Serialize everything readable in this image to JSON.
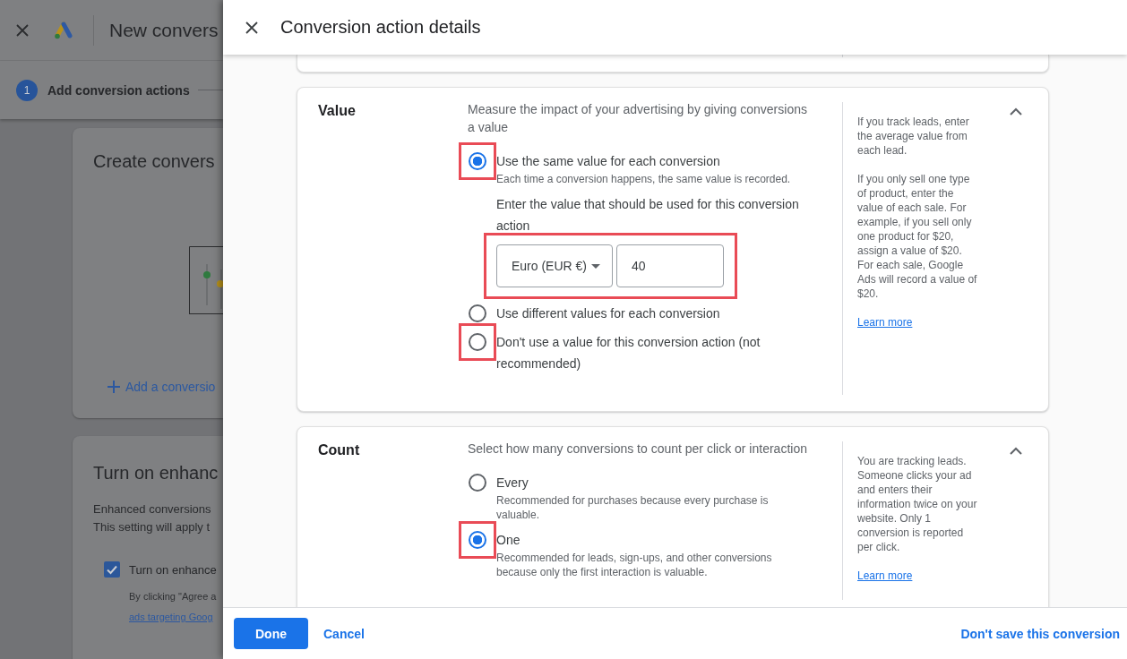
{
  "background_page": {
    "header": {
      "title": "New convers"
    },
    "stepper": [
      {
        "number": "1",
        "label": "Add conversion actions"
      }
    ],
    "create_card": {
      "title": "Create convers",
      "add_link": "Add a conversio"
    },
    "enhanced_card": {
      "title": "Turn on enhanc",
      "description_lines": [
        "Enhanced conversions",
        "This setting will apply t"
      ],
      "checkbox": {
        "label": "Turn on enhance",
        "checked": true
      },
      "terms": "By clicking \"Agree a",
      "terms_link": "ads targeting Goog"
    }
  },
  "drawer": {
    "title": "Conversion action details"
  },
  "sections": [
    {
      "title": "Value",
      "expanded": true,
      "intro": "Measure the impact of your advertising by giving conversions a value",
      "options": [
        {
          "label": "Use the same value for each conversion",
          "description": "Each time a conversion happens, the same value is recorded.",
          "selected": true,
          "highlighted": true,
          "value_entry": {
            "prompt": "Enter the value that should be used for this conversion action",
            "currency": "Euro (EUR €)",
            "value": "40",
            "highlighted": true
          }
        },
        {
          "label": "Use different values for each conversion",
          "selected": false,
          "highlighted": false
        },
        {
          "label": "Don't use a value for this conversion action (not recommended)",
          "selected": false,
          "highlighted": true
        }
      ],
      "help": [
        "If you track leads, enter the average value from each lead.",
        "If you only sell one type of product, enter the value of each sale. For example, if you sell only one product for $20, assign a value of $20. For each sale, Google Ads will record a value of $20."
      ],
      "learn_more": "Learn more"
    },
    {
      "title": "Count",
      "expanded": true,
      "intro": "Select how many conversions to count per click or interaction",
      "options": [
        {
          "label": "Every",
          "description": "Recommended for purchases because every purchase is valuable.",
          "selected": false,
          "highlighted": false
        },
        {
          "label": "One",
          "description": "Recommended for leads, sign-ups, and other conversions because only the first interaction is valuable.",
          "selected": true,
          "highlighted": true
        }
      ],
      "help": [
        "You are tracking leads. Someone clicks your ad and enters their information twice on your website. Only 1 conversion is reported per click."
      ],
      "learn_more": "Learn more"
    }
  ],
  "footer": {
    "done": "Done",
    "cancel": "Cancel",
    "dont_save": "Don't save this conversion"
  }
}
